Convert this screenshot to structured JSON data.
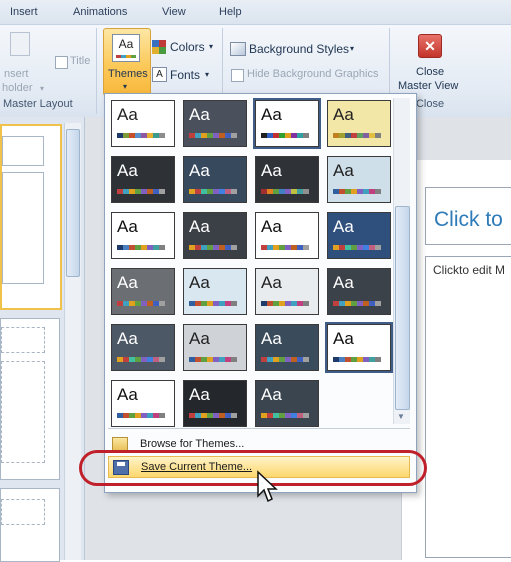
{
  "tabs": {
    "insert": "Insert",
    "animations": "Animations",
    "view": "View",
    "help": "Help"
  },
  "ribbon": {
    "insert_placeholder": {
      "line1": "nsert",
      "line2": "holder"
    },
    "title_checkbox": "Title",
    "master_layout_group": "Master Layout",
    "themes_button": "Themes",
    "themes_icon_text": "Aa",
    "colors_button": "Colors",
    "fonts_button": "Fonts",
    "background_styles": "Background Styles",
    "hide_background_graphics": "Hide Background Graphics",
    "close_master_view": {
      "line1": "Close",
      "line2": "Master View"
    },
    "close_group": "Close",
    "dropdown_arrow": "▾"
  },
  "gallery": {
    "themes": [
      {
        "text": "Aa",
        "bg": "#ffffff",
        "fg": "#222222",
        "sw": [
          "#1f3b6b",
          "#7d9b3b",
          "#c85028",
          "#5a8fc8",
          "#8c5aa3",
          "#e8b030",
          "#3b9b8c",
          "#8c8c8c"
        ]
      },
      {
        "text": "Aa",
        "bg": "#4a515c",
        "fg": "#ffffff",
        "sw": [
          "#c04040",
          "#40a0c0",
          "#e0a020",
          "#60a040",
          "#8060c0",
          "#c06020",
          "#4060c0",
          "#a0a0a0"
        ]
      },
      {
        "text": "Aa",
        "bg": "#ffffff",
        "fg": "#111111",
        "sw": [
          "#202020",
          "#3060c0",
          "#c03030",
          "#30a030",
          "#e0a020",
          "#8030a0",
          "#30a0a0",
          "#808080"
        ]
      },
      {
        "text": "Aa",
        "bg": "#f3e7a8",
        "fg": "#222222",
        "sw": [
          "#c08020",
          "#a0a030",
          "#406080",
          "#c04040",
          "#60a060",
          "#8060a0",
          "#e0c040",
          "#808080"
        ]
      },
      {
        "text": "Aa",
        "bg": "#2e3237",
        "fg": "#ffffff",
        "sw": [
          "#c04040",
          "#40a0c0",
          "#e0a020",
          "#60a040",
          "#8060c0",
          "#c06020",
          "#4060c0",
          "#a0a0a0"
        ]
      },
      {
        "text": "Aa",
        "bg": "#37495c",
        "fg": "#ffffff",
        "sw": [
          "#e0a020",
          "#c04040",
          "#40c0a0",
          "#60a040",
          "#8060c0",
          "#4080e0",
          "#c06080",
          "#a0a0a0"
        ]
      },
      {
        "text": "Aa",
        "bg": "#2f3338",
        "fg": "#ffffff",
        "sw": [
          "#a03030",
          "#e08020",
          "#60a040",
          "#4080c0",
          "#8060c0",
          "#c0c040",
          "#40a0a0",
          "#909090"
        ]
      },
      {
        "text": "Aa",
        "bg": "#cfdfe9",
        "fg": "#222222",
        "sw": [
          "#3060a0",
          "#c05030",
          "#60a040",
          "#e0a020",
          "#8060c0",
          "#40a0c0",
          "#c04080",
          "#808080"
        ]
      },
      {
        "text": "Aa",
        "bg": "#ffffff",
        "fg": "#111111",
        "sw": [
          "#1f3b6b",
          "#4a80c0",
          "#c05030",
          "#60a040",
          "#e0a020",
          "#8060c0",
          "#40a0a0",
          "#808080"
        ]
      },
      {
        "text": "Aa",
        "bg": "#3b3f46",
        "fg": "#ffffff",
        "sw": [
          "#e0a020",
          "#c04040",
          "#40a0c0",
          "#60a040",
          "#8060c0",
          "#c06020",
          "#4060c0",
          "#a0a0a0"
        ]
      },
      {
        "text": "Aa",
        "bg": "#ffffff",
        "fg": "#111111",
        "sw": [
          "#c04040",
          "#40a0c0",
          "#e0a020",
          "#60a040",
          "#8060c0",
          "#c06020",
          "#4060c0",
          "#a0a0a0"
        ]
      },
      {
        "text": "Aa",
        "bg": "#2f4f7d",
        "fg": "#ffffff",
        "sw": [
          "#e0a020",
          "#c04040",
          "#40c0a0",
          "#60a040",
          "#8060c0",
          "#4080e0",
          "#c06080",
          "#a0a0a0"
        ]
      },
      {
        "text": "Aa",
        "bg": "#6b6e73",
        "fg": "#ffffff",
        "sw": [
          "#c04040",
          "#40a0c0",
          "#e0a020",
          "#60a040",
          "#8060c0",
          "#c06020",
          "#4060c0",
          "#a0a0a0"
        ]
      },
      {
        "text": "Aa",
        "bg": "#d8e7f0",
        "fg": "#222222",
        "sw": [
          "#3060a0",
          "#c05030",
          "#60a040",
          "#e0a020",
          "#8060c0",
          "#40a0c0",
          "#c04080",
          "#808080"
        ]
      },
      {
        "text": "Aa",
        "bg": "#e9ecef",
        "fg": "#222222",
        "sw": [
          "#1f3b6b",
          "#c05030",
          "#60a040",
          "#e0a020",
          "#8060c0",
          "#40a0c0",
          "#c04080",
          "#808080"
        ]
      },
      {
        "text": "Aa",
        "bg": "#3c4249",
        "fg": "#ffffff",
        "sw": [
          "#c04040",
          "#40a0c0",
          "#e0a020",
          "#60a040",
          "#8060c0",
          "#c06020",
          "#4060c0",
          "#a0a0a0"
        ]
      },
      {
        "text": "Aa",
        "bg": "#4c5865",
        "fg": "#ffffff",
        "sw": [
          "#e0a020",
          "#c04040",
          "#40c0a0",
          "#60a040",
          "#8060c0",
          "#4080e0",
          "#c06080",
          "#a0a0a0"
        ]
      },
      {
        "text": "Aa",
        "bg": "#cfd3d8",
        "fg": "#222222",
        "sw": [
          "#3060a0",
          "#c05030",
          "#60a040",
          "#e0a020",
          "#8060c0",
          "#40a0c0",
          "#c04080",
          "#808080"
        ]
      },
      {
        "text": "Aa",
        "bg": "#3a4b5c",
        "fg": "#ffffff",
        "sw": [
          "#c04040",
          "#40a0c0",
          "#e0a020",
          "#60a040",
          "#8060c0",
          "#c06020",
          "#4060c0",
          "#a0a0a0"
        ]
      },
      {
        "text": "Aa",
        "bg": "#ffffff",
        "fg": "#111111",
        "sw": [
          "#1f3b6b",
          "#4a80c0",
          "#c05030",
          "#60a040",
          "#e0a020",
          "#8060c0",
          "#40a0a0",
          "#808080"
        ]
      },
      {
        "text": "Aa",
        "bg": "#ffffff",
        "fg": "#111111",
        "sw": [
          "#3060a0",
          "#c05030",
          "#60a040",
          "#e0a020",
          "#8060c0",
          "#40a0c0",
          "#c04080",
          "#808080"
        ]
      },
      {
        "text": "Aa",
        "bg": "#24282d",
        "fg": "#ffffff",
        "sw": [
          "#c04040",
          "#40a0c0",
          "#e0a020",
          "#60a040",
          "#8060c0",
          "#c06020",
          "#4060c0",
          "#a0a0a0"
        ]
      },
      {
        "text": "Aa",
        "bg": "#3a4550",
        "fg": "#ffffff",
        "sw": [
          "#e0a020",
          "#c04040",
          "#40c0a0",
          "#60a040",
          "#8060c0",
          "#4080e0",
          "#c06080",
          "#a0a0a0"
        ]
      }
    ],
    "browse_for_themes": "Browse for Themes...",
    "save_current_theme": "Save Current Theme..."
  },
  "slide": {
    "title_placeholder": "Click to",
    "body_placeholder": "Clickto edit M"
  }
}
